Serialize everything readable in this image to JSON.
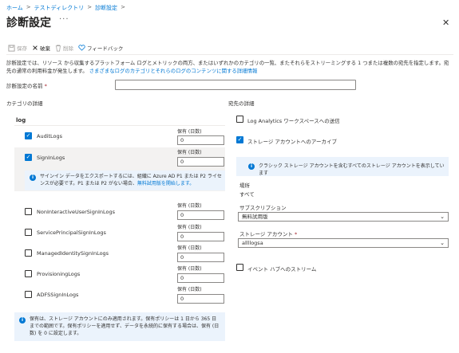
{
  "breadcrumb": {
    "items": [
      "ホーム",
      "テストディレクトリ",
      "診断設定"
    ],
    "separator": ">"
  },
  "page": {
    "title": "診断設定",
    "more": "···",
    "close": "✕"
  },
  "toolbar": {
    "save": "保存",
    "discard": "破棄",
    "delete": "削除",
    "feedback": "フィードバック"
  },
  "description": {
    "text": "診断設定では、リソース から収集するプラットフォーム ログとメトリックの両方、またはいずれかのカテゴリの一覧、またそれらをストリーミングする 1 つまたは複数の宛先を指定します。宛先の通常の利用料金が発生します。",
    "link": "さまざまなログのカテゴリとそれらのログのコンテンツに関する詳細情報"
  },
  "name_field": {
    "label": "診断設定の名前",
    "required": "*",
    "value": ""
  },
  "categories": {
    "header": "カテゴリの詳細",
    "group": "log",
    "retention_label": "保有 (日数)",
    "items": [
      {
        "name": "AuditLogs",
        "checked": true,
        "retention": "0"
      },
      {
        "name": "SignInLogs",
        "checked": true,
        "retention": "0"
      },
      {
        "name": "NonInteractiveUserSignInLogs",
        "checked": false,
        "retention": "0"
      },
      {
        "name": "ServicePrincipalSignInLogs",
        "checked": false,
        "retention": "0"
      },
      {
        "name": "ManagedIdentitySignInLogs",
        "checked": false,
        "retention": "0"
      },
      {
        "name": "ProvisioningLogs",
        "checked": false,
        "retention": "0"
      },
      {
        "name": "ADFSSignInLogs",
        "checked": false,
        "retention": "0"
      }
    ],
    "signin_info": "サインイン データをエクスポートするには、組織に Azure AD P1 または P2 ライセンスが必要です。P1 または P2 がない場合、",
    "signin_info_link": "無料試用版を開始します。",
    "retention_info": "保有は、ストレージ アカウントにのみ適用されます。保有ポリシーは 1 日から 365 日までの範囲です。保有ポリシーを適用せず、データを永続的に保有する場合は、保有 (日数) を 0 に設定します。"
  },
  "destination": {
    "header": "宛先の詳細",
    "log_analytics": {
      "label": "Log Analytics ワークスペースへの送信",
      "checked": false
    },
    "storage": {
      "label": "ストレージ アカウントへのアーカイブ",
      "checked": true
    },
    "storage_info": "クラシック ストレージ アカウントを含むすべてのストレージ アカウントを表示しています",
    "location_label": "場所",
    "location_value": "すべて",
    "subscription_label": "サブスクリプション",
    "subscription_value": "無料試用版",
    "storage_account_label": "ストレージ アカウント",
    "storage_account_required": "*",
    "storage_account_value": "allllogsa",
    "event_hub": {
      "label": "イベント ハブへのストリーム",
      "checked": false
    }
  },
  "colors": {
    "accent": "#0078d4",
    "info_bg": "#ebf3fc",
    "selected_row": "#f3f2f1"
  }
}
